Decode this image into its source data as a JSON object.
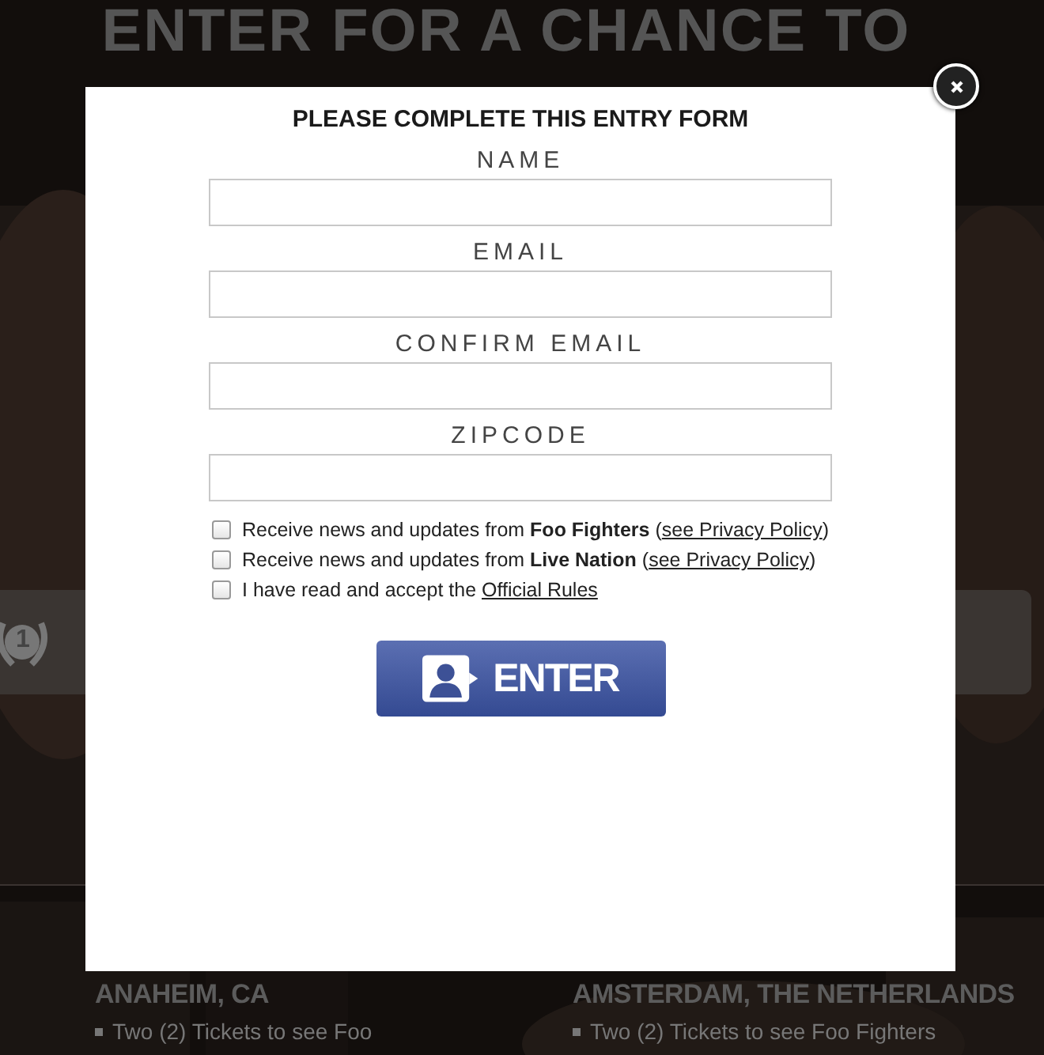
{
  "background": {
    "headline": [
      "ENTER FOR A CHANCE TO"
    ],
    "badge": "1",
    "prizes": [
      {
        "city": "ANAHEIM, CA",
        "items": [
          "Two (2) Tickets to see Foo"
        ]
      },
      {
        "city": "AMSTERDAM, THE NETHERLANDS",
        "items": [
          "Two (2) Tickets to see Foo Fighters"
        ]
      }
    ]
  },
  "modal": {
    "title": "PLEASE COMPLETE THIS ENTRY FORM",
    "fields": [
      {
        "label": "NAME"
      },
      {
        "label": "EMAIL"
      },
      {
        "label": "CONFIRM EMAIL"
      },
      {
        "label": "ZIPCODE"
      }
    ],
    "options": [
      {
        "text": "Receive news and updates from **Foo Fighters** (",
        "link": "see Privacy Policy",
        "after": ")",
        "checked": false
      },
      {
        "text": "Receive news and updates from **Live Nation** (",
        "link": "see Privacy Policy",
        "after": ")",
        "checked": false
      },
      {
        "text": "I have read and accept the ",
        "link": "Official Rules",
        "checked": false
      }
    ],
    "submit": "ENTER"
  }
}
